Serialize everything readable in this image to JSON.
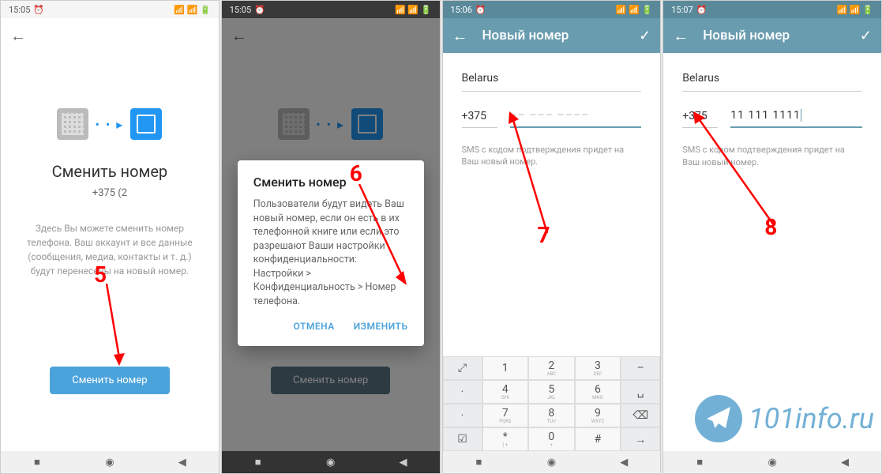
{
  "screens": [
    {
      "status": {
        "time": "15:05",
        "alarm": true
      },
      "title": "Сменить номер",
      "phone": "+375 (2",
      "desc": "Здесь Вы можете сменить номер телефона. Ваш аккаунт и все данные (сообщения, медиа, контакты и т. д.) будут перенесены на новый номер.",
      "button": "Сменить номер"
    },
    {
      "status": {
        "time": "15:05",
        "alarm": true
      },
      "title": "Сменить номер",
      "button": "Сменить номер",
      "dialog": {
        "title": "Сменить номер",
        "text": "Пользователи будут видеть Ваш новый номер, если он есть в их телефонной книге или если это разрешают Ваши настройки конфиденциальности: Настройки > Конфиденциальность > Номер телефона.",
        "cancel": "ОТМЕНА",
        "confirm": "ИЗМЕНИТЬ"
      }
    },
    {
      "status": {
        "time": "15:06",
        "alarm": true
      },
      "header": "Новый номер",
      "country": "Belarus",
      "code": "+375",
      "number_placeholder": "–– ––– ––––",
      "sms_hint": "SMS с кодом подтверждения придет на Ваш новый номер."
    },
    {
      "status": {
        "time": "15:07",
        "alarm": true
      },
      "header": "Новый номер",
      "country": "Belarus",
      "code": "+375",
      "number_value": "11 111 1111",
      "sms_hint": "SMS с кодом подтверждения придет на Ваш новый номер."
    }
  ],
  "keypad": {
    "keys": [
      {
        "n": "1",
        "l": ""
      },
      {
        "n": "2",
        "l": "ABC"
      },
      {
        "n": "3",
        "l": "DEF"
      },
      {
        "n": "4",
        "l": "GHI"
      },
      {
        "n": "5",
        "l": "JKL"
      },
      {
        "n": "6",
        "l": "MNO"
      },
      {
        "n": "7",
        "l": "PQRS"
      },
      {
        "n": "8",
        "l": "TUV"
      },
      {
        "n": "9",
        "l": "WXYZ"
      },
      {
        "n": "*",
        "l": "(+"
      },
      {
        "n": "0",
        "l": "+"
      },
      {
        "n": "#",
        "l": ""
      }
    ],
    "side_left": [
      "⤢",
      "·",
      "·",
      "☑"
    ],
    "side_right": [
      "–",
      "␣",
      "⌫",
      "→"
    ]
  },
  "annotations": {
    "5": "5",
    "6": "6",
    "7": "7",
    "8": "8"
  },
  "watermark": "101info.ru"
}
